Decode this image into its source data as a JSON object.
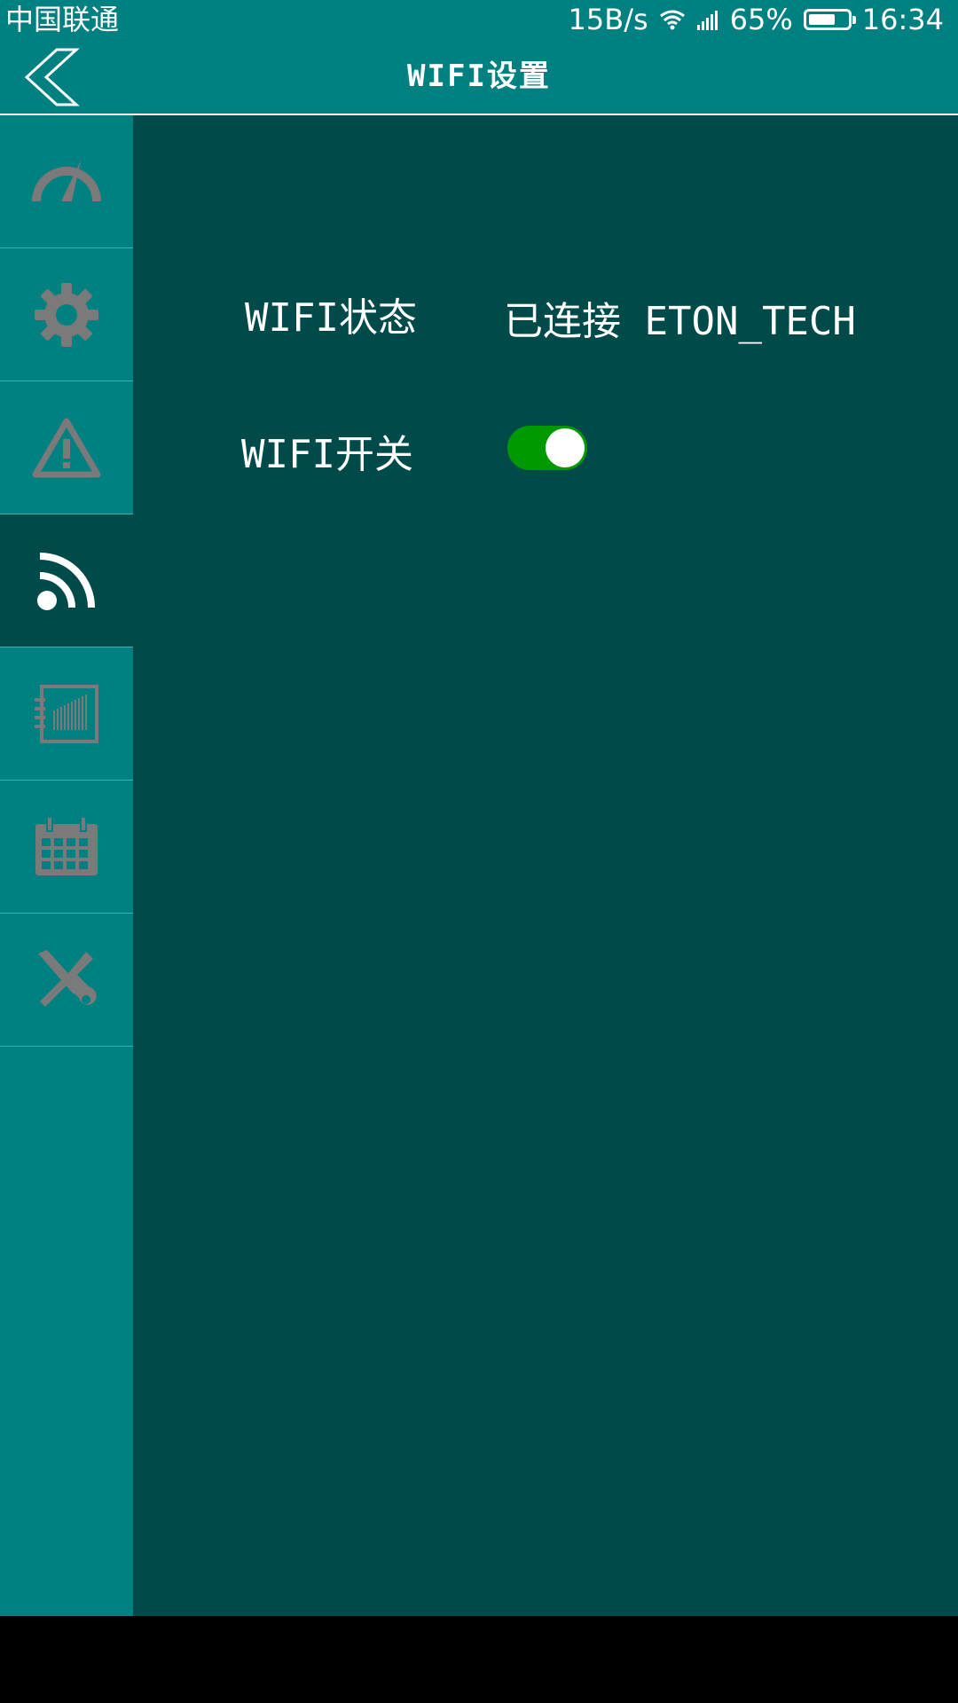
{
  "status_bar": {
    "carrier": "中国联通",
    "net_speed": "15B/s",
    "battery": "65%",
    "battery_level": 0.65,
    "time": "16:34"
  },
  "header": {
    "title": "WIFI设置",
    "back_icon": "chevron-left-icon"
  },
  "sidebar": {
    "items": [
      {
        "name": "dashboard",
        "icon": "gauge-icon",
        "active": false
      },
      {
        "name": "settings",
        "icon": "gear-icon",
        "active": false
      },
      {
        "name": "alarm",
        "icon": "warning-icon",
        "active": false
      },
      {
        "name": "wifi",
        "icon": "wifi-icon",
        "active": true
      },
      {
        "name": "records",
        "icon": "notebook-icon",
        "active": false
      },
      {
        "name": "calendar",
        "icon": "calendar-icon",
        "active": false
      },
      {
        "name": "tools",
        "icon": "tools-icon",
        "active": false
      }
    ],
    "icon_color": "#7a7a7a",
    "active_icon_color": "#ffffff"
  },
  "main": {
    "wifi_status_label": "WIFI状态",
    "wifi_status_value": "已连接 ETON_TECH",
    "wifi_switch_label": "WIFI开关",
    "wifi_switch_on": true
  },
  "colors": {
    "primary": "#008080",
    "content_bg": "#004a4a",
    "toggle_on": "#009900"
  }
}
